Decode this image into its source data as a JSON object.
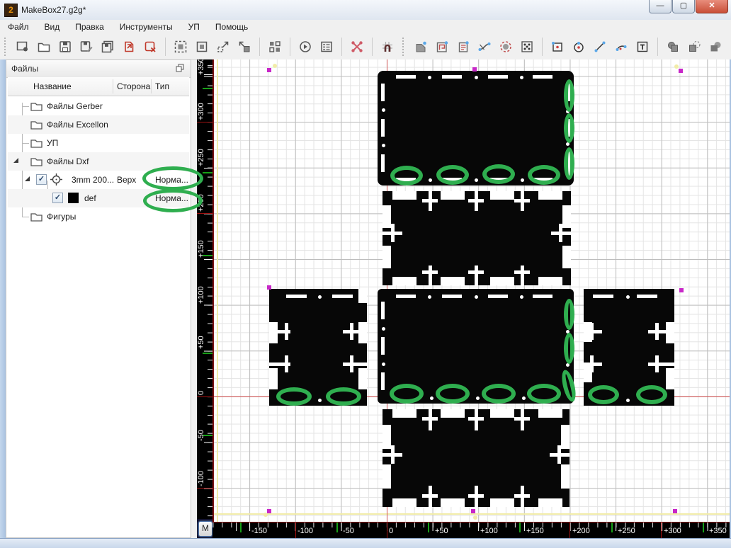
{
  "window": {
    "title": "MakeBox27.g2g*",
    "buttons": [
      {
        "name": "minimize",
        "glyph": "—"
      },
      {
        "name": "maximize",
        "glyph": "▢"
      },
      {
        "name": "close",
        "glyph": "✕"
      }
    ]
  },
  "menu": {
    "items": [
      "Файл",
      "Вид",
      "Правка",
      "Инструменты",
      "УП",
      "Помощь"
    ]
  },
  "toolbar": {
    "icons": [
      "new-project",
      "open",
      "save",
      "save-as",
      "save-all",
      "import-file",
      "close-file",
      "zoom-extents",
      "zoom-window",
      "zoom-out",
      "zoom-in",
      "tile-view",
      "run",
      "properties",
      "frame-marks",
      "snap-grid",
      "polygon-tool",
      "pocket-tool",
      "gcode-doc",
      "curve-tool",
      "drill-tool",
      "pattern-tool",
      "draw-rect",
      "draw-circle",
      "draw-line",
      "draw-arc",
      "draw-text",
      "bool-union",
      "bool-subtract",
      "bool-intersect"
    ]
  },
  "files_panel": {
    "title": "Файлы",
    "columns": [
      "Название",
      "Сторона",
      "Тип"
    ],
    "folders": [
      "Файлы Gerber",
      "Файлы Excellon",
      "УП",
      "Файлы Dxf",
      "Фигуры"
    ],
    "dxf_file": {
      "name": "3mm 200...",
      "side": "Верх",
      "type": "Норма...",
      "checked": true
    },
    "def_layer": {
      "name": "def",
      "type": "Норма...",
      "checked": true
    }
  },
  "canvas": {
    "h_ruler": {
      "labels": [
        "-150",
        "-100",
        "-50",
        "0",
        "+50",
        "+100",
        "+150",
        "+200",
        "+250",
        "+300",
        "+350"
      ]
    },
    "v_ruler": {
      "labels": [
        "+350",
        "+300",
        "+250",
        "+200",
        "+150",
        "+100",
        "+50",
        "0",
        "-50",
        "-100"
      ]
    },
    "m_button": "M"
  },
  "colors": {
    "annotation_green": "#2fae4f",
    "axis_red": "#c83232",
    "marker_magenta": "#c827c8",
    "guide_yellow": "#f1eca8",
    "layer_swatch": "#000000"
  }
}
